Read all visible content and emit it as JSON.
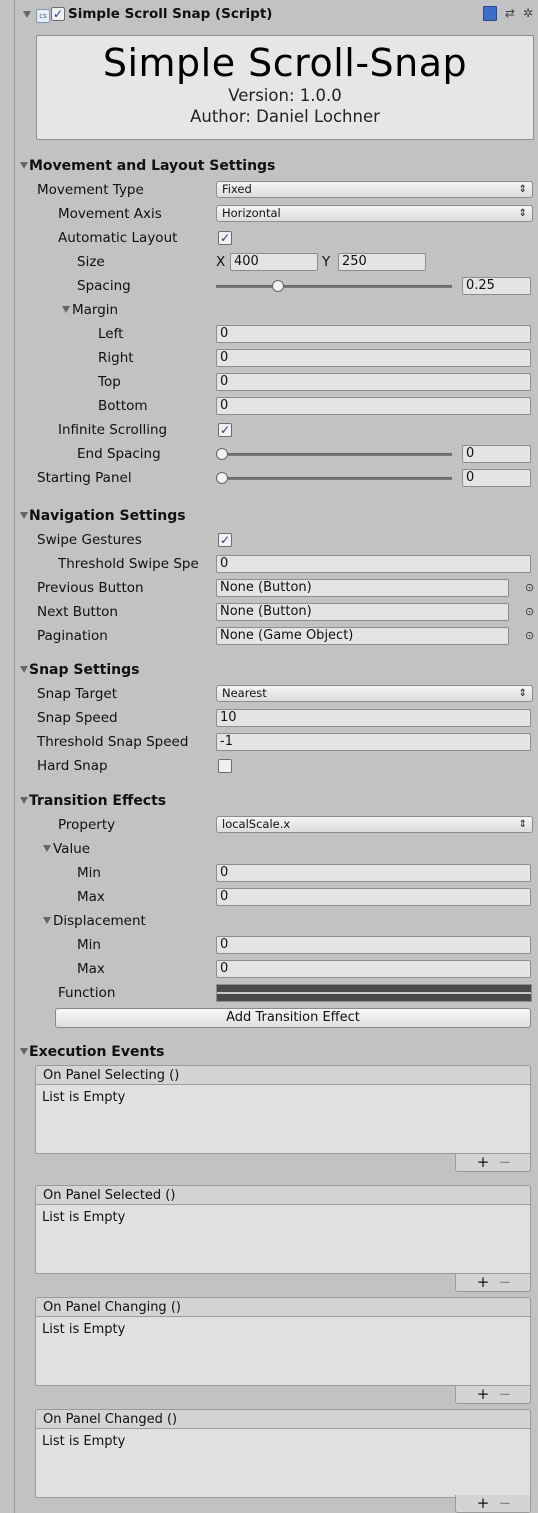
{
  "header": {
    "title": "Simple Scroll Snap (Script)",
    "script_icon": "cs",
    "enabled_check": "✓"
  },
  "titlebox": {
    "title": "Simple Scroll-Snap",
    "version": "Version: 1.0.0",
    "author": "Author: Daniel Lochner"
  },
  "movement": {
    "section": "Movement and Layout Settings",
    "movement_type_label": "Movement Type",
    "movement_type": "Fixed",
    "movement_axis_label": "Movement Axis",
    "movement_axis": "Horizontal",
    "auto_layout_label": "Automatic Layout",
    "auto_layout_check": "✓",
    "size_label": "Size",
    "size_x_label": "X",
    "size_x": "400",
    "size_y_label": "Y",
    "size_y": "250",
    "spacing_label": "Spacing",
    "spacing_value": "0.25",
    "spacing_fraction": 0.25,
    "margin_label": "Margin",
    "left_label": "Left",
    "left": "0",
    "right_label": "Right",
    "right": "0",
    "top_label": "Top",
    "top": "0",
    "bottom_label": "Bottom",
    "bottom": "0",
    "infinite_label": "Infinite Scrolling",
    "infinite_check": "✓",
    "end_spacing_label": "End Spacing",
    "end_spacing": "0",
    "starting_panel_label": "Starting Panel",
    "starting_panel": "0"
  },
  "navigation": {
    "section": "Navigation Settings",
    "swipe_label": "Swipe Gestures",
    "swipe_check": "✓",
    "threshold_label": "Threshold Swipe Spe",
    "threshold": "0",
    "prev_label": "Previous Button",
    "prev": "None (Button)",
    "next_label": "Next Button",
    "next": "None (Button)",
    "pagination_label": "Pagination",
    "pagination": "None (Game Object)",
    "picker_icon": "⊙"
  },
  "snap": {
    "section": "Snap Settings",
    "target_label": "Snap Target",
    "target": "Nearest",
    "speed_label": "Snap Speed",
    "speed": "10",
    "threshold_label": "Threshold Snap Speed",
    "threshold": "-1",
    "hard_label": "Hard Snap",
    "hard_check": ""
  },
  "transition": {
    "section": "Transition Effects",
    "property_label": "Property",
    "property": "localScale.x",
    "value_label": "Value",
    "value_min_label": "Min",
    "value_min": "0",
    "value_max_label": "Max",
    "value_max": "0",
    "disp_label": "Displacement",
    "disp_min_label": "Min",
    "disp_min": "0",
    "disp_max_label": "Max",
    "disp_max": "0",
    "function_label": "Function",
    "add_button": "Add Transition Effect"
  },
  "events": {
    "section": "Execution Events",
    "empty": "List is Empty",
    "plus": "+",
    "minus": "−",
    "items": [
      {
        "title": "On Panel Selecting ()"
      },
      {
        "title": "On Panel Selected ()"
      },
      {
        "title": "On Panel Changing ()"
      },
      {
        "title": "On Panel Changed ()"
      }
    ]
  },
  "popup_arrow": "⇕"
}
